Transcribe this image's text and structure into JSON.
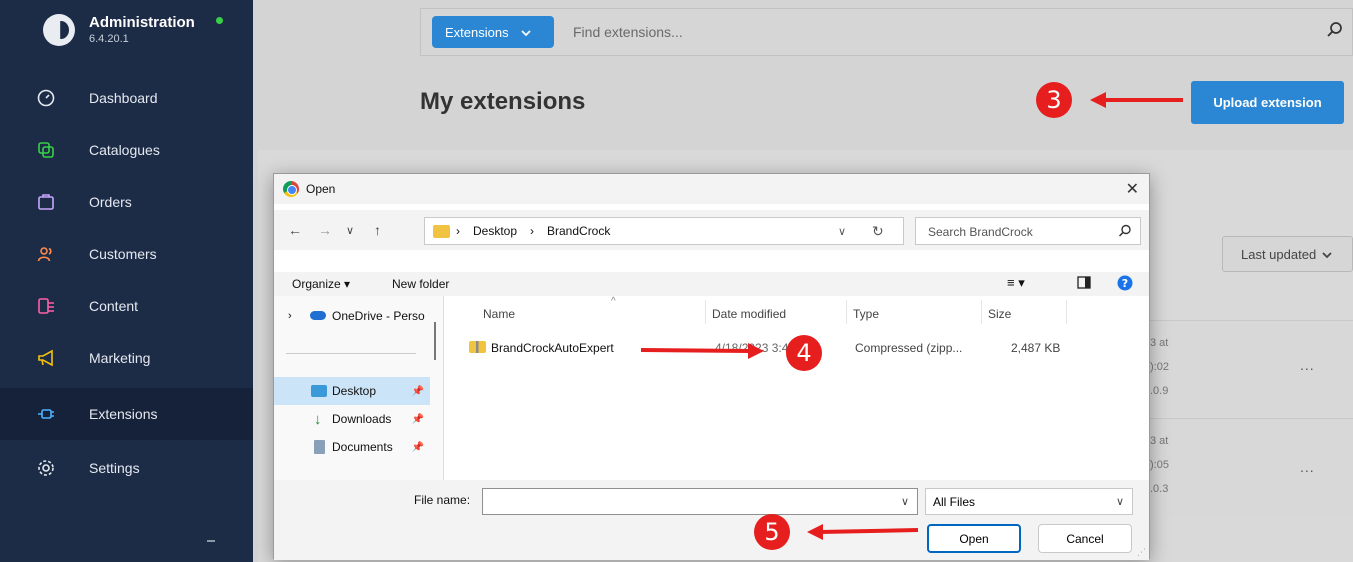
{
  "sidebar": {
    "app_title": "Administration",
    "version": "6.4.20.1",
    "items": [
      {
        "label": "Dashboard"
      },
      {
        "label": "Catalogues"
      },
      {
        "label": "Orders"
      },
      {
        "label": "Customers"
      },
      {
        "label": "Content"
      },
      {
        "label": "Marketing"
      },
      {
        "label": "Extensions"
      },
      {
        "label": "Settings"
      }
    ]
  },
  "header": {
    "scope_button": "Extensions",
    "search_placeholder": "Find extensions..."
  },
  "page": {
    "title": "My extensions",
    "upload_button": "Upload extension",
    "sort_label": "Last updated",
    "rows": [
      {
        "line1": "3 at",
        "line2": "):02",
        "line3": ".0.9",
        "actions": "..."
      },
      {
        "line1": "3 at",
        "line2": "):05",
        "line3": ".0.3",
        "actions": "..."
      }
    ]
  },
  "dialog": {
    "title": "Open",
    "breadcrumb": [
      "Desktop",
      "BrandCrock"
    ],
    "search_placeholder": "Search BrandCrock",
    "organize": "Organize",
    "new_folder": "New folder",
    "nav_pane": {
      "onedrive": "OneDrive - Perso",
      "items": [
        "Desktop",
        "Downloads",
        "Documents"
      ]
    },
    "columns": [
      "Name",
      "Date modified",
      "Type",
      "Size"
    ],
    "files": [
      {
        "name": "BrandCrockAutoExpert",
        "date": "4/18/2023 3:4",
        "type": "Compressed (zipp...",
        "size": "2,487 KB"
      }
    ],
    "file_name_label": "File name:",
    "file_name_value": "",
    "file_type": "All Files",
    "open_button": "Open",
    "cancel_button": "Cancel"
  },
  "annotations": {
    "step3": "3",
    "step4": "4",
    "step5": "5",
    "color": "#e61e1e"
  },
  "colors": {
    "sidebar_bg": "#1c2b46",
    "accent": "#2b87d3",
    "online": "#37d046"
  }
}
